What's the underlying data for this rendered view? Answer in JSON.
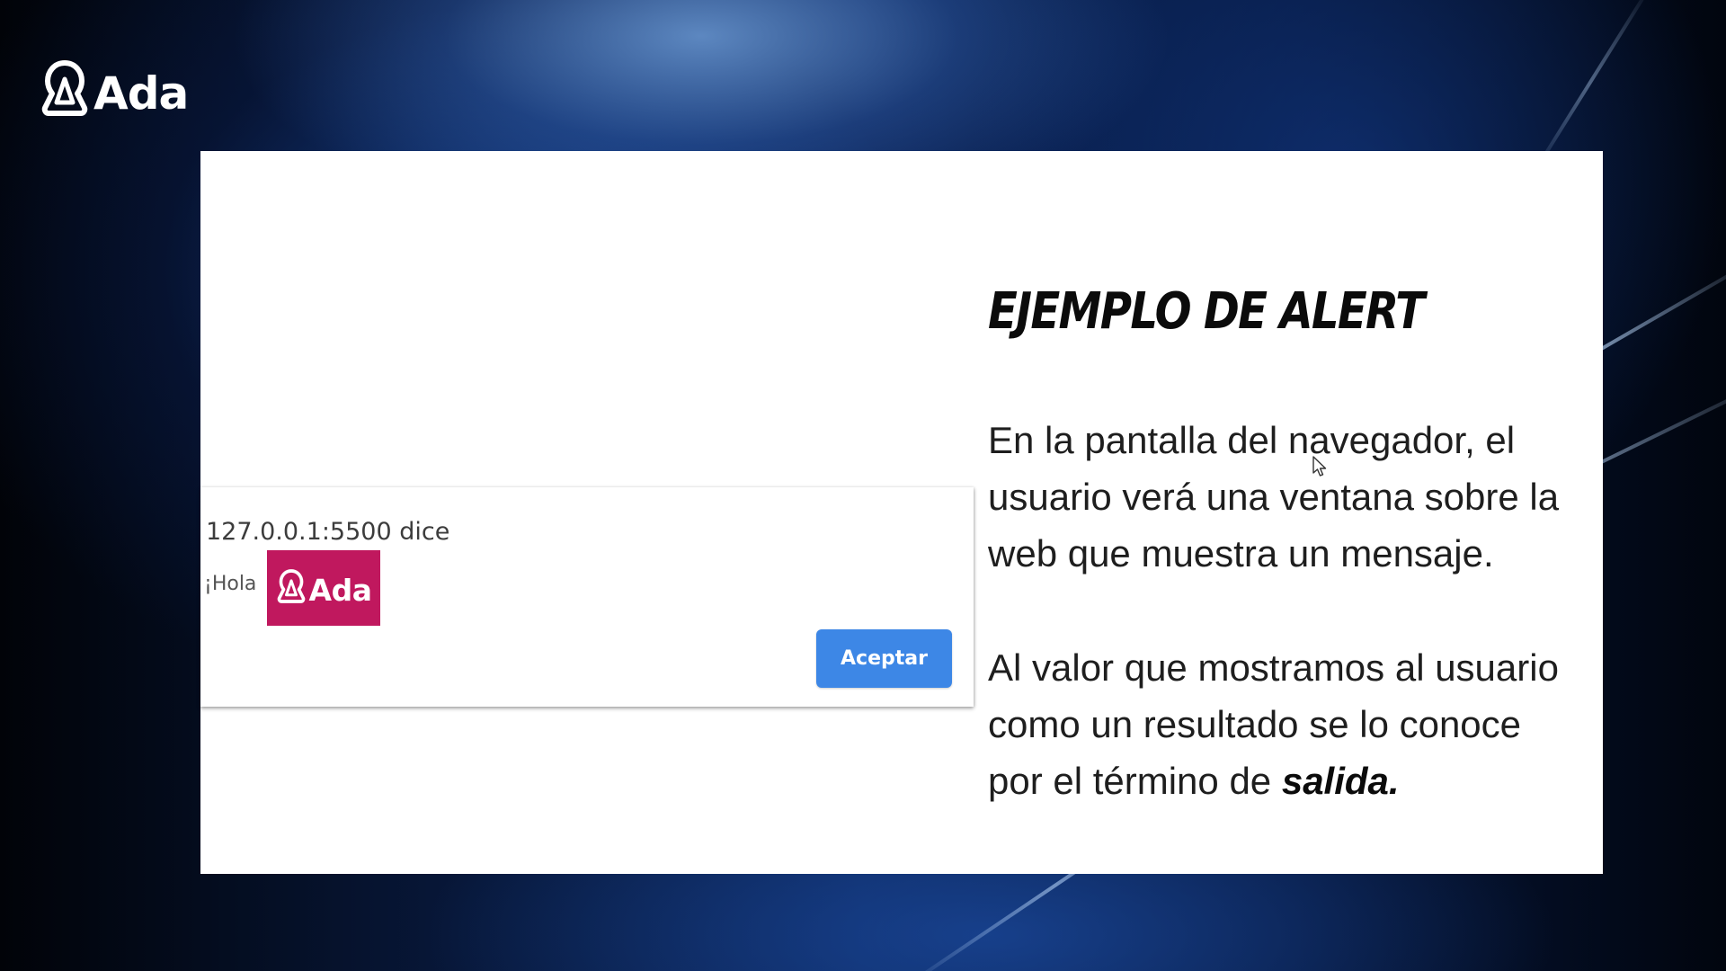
{
  "brand": {
    "logo_text": "Ada",
    "badge_color": "#c0185e"
  },
  "slide": {
    "title": "EJEMPLO DE ALERT",
    "paragraph1": "En la pantalla del navegador, el usuario verá una ventana sobre la web que muestra un mensaje.",
    "paragraph2_lead": "Al valor que mostramos al usuario como un resultado se lo conoce por el término de",
    "paragraph2_emphasis": "salida."
  },
  "alert_dialog": {
    "origin": "127.0.0.1:5500 dice",
    "message": "¡Hola",
    "badge_text": "Ada",
    "accept_label": "Aceptar",
    "accept_color": "#3d87e6"
  },
  "icons": {
    "logo": "ada-logo-icon",
    "pointer": "mouse-pointer-icon"
  }
}
